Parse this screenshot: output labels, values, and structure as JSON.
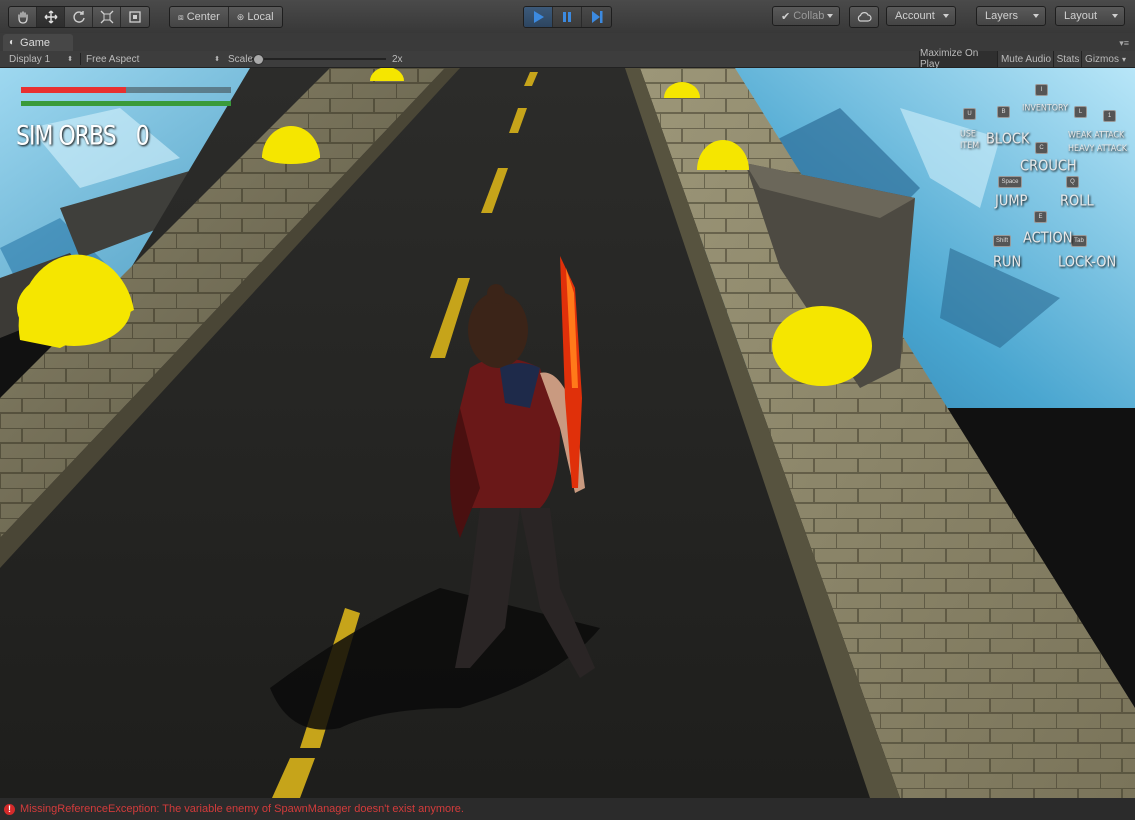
{
  "toolbar": {
    "tools": [
      "hand-tool",
      "move-tool",
      "rotate-tool",
      "scale-tool",
      "rect-tool"
    ],
    "pivot_center": "Center",
    "pivot_local": "Local",
    "collab": "Collab",
    "account": "Account",
    "layers": "Layers",
    "layout": "Layout"
  },
  "game_tab": {
    "title": "Game",
    "display": "Display 1",
    "aspect": "Free Aspect",
    "scale_label": "Scale",
    "scale_value": "2x",
    "maximize_on_play": "Maximize On Play",
    "mute_audio": "Mute Audio",
    "stats": "Stats",
    "gizmos": "Gizmos"
  },
  "hud": {
    "orb_label": "SIM ORBS",
    "orb_count": "0",
    "health_fraction": 0.5,
    "stamina_fraction": 1.0,
    "controls": {
      "inventory": "INVENTORY",
      "use_item": "USE ITEM",
      "block": "BLOCK",
      "weak_attack": "WEAK ATTACK",
      "heavy_attack": "HEAVY ATTACK",
      "crouch": "CROUCH",
      "jump": "JUMP",
      "roll": "ROLL",
      "action": "ACTION",
      "run": "RUN",
      "lock_on": "LOCK-ON"
    },
    "keys": {
      "inventory": "I",
      "use_item": "U",
      "block": "B",
      "weak": "L",
      "heavy": "1",
      "crouch": "C",
      "jump": "Space",
      "roll": "Q",
      "action": "E",
      "run": "Shift",
      "lock_on": "Tab"
    }
  },
  "status": {
    "message": "MissingReferenceException: The variable enemy of SpawnManager doesn't exist anymore."
  },
  "colors": {
    "health": "#e83030",
    "stamina": "#3a9a3a",
    "orb": "#f5e600",
    "error": "#d23b3b",
    "play_active": "#3c7bd0"
  }
}
